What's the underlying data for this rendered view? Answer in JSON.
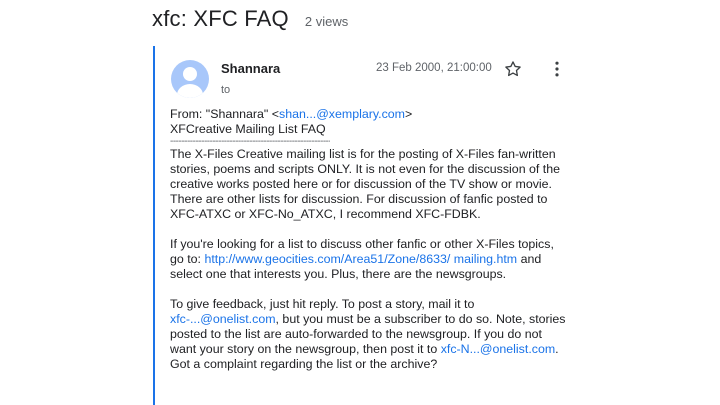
{
  "thread": {
    "title": "xfc: XFC FAQ",
    "views": "2 views"
  },
  "message": {
    "sender": "Shannara",
    "to_label": "to",
    "date": "23 Feb 2000, 21:00:00",
    "from_prefix": "From: \"Shannara\" <",
    "from_email": "shan...@xemplary.com",
    "from_suffix": ">",
    "list_title": "XFCreative Mailing List FAQ",
    "dashes": "----------------------------------------------------------",
    "para1": "The X-Files Creative mailing list is for the posting of X-Files fan-written stories, poems and scripts ONLY. It is not even for the discussion of the creative works posted here or for discussion of the TV show or movie. There are other lists for discussion. For discussion of fanfic posted to XFC-ATXC or XFC-No_ATXC, I recommend XFC-FDBK.",
    "para2_prefix": "If you're looking for a list to discuss other fanfic or other X-Files topics, go to: ",
    "para2_link": "http://www.geocities.com/Area51/Zone/8633/ mailing.htm",
    "para2_suffix": " and select one that interests you. Plus, there are the newsgroups.",
    "para3_prefix": "To give feedback, just hit reply. To post a story, mail it to ",
    "para3_link1": "xfc-...@onelist.com",
    "para3_mid": ", but you must be a subscriber to do so. Note, stories posted to the list are auto-forwarded to the newsgroup. If you do not want your story on the newsgroup, then post it to ",
    "para3_link2": "xfc-N...@onelist.com",
    "para3_suffix": ". Got a complaint regarding the list or the archive?"
  },
  "icons": {
    "star": "star-icon",
    "more": "more-vert-icon",
    "avatar": "person-avatar"
  },
  "colors": {
    "accent": "#1a73e8",
    "avatar_bg": "#a8c7fa",
    "muted": "#5f6368"
  }
}
